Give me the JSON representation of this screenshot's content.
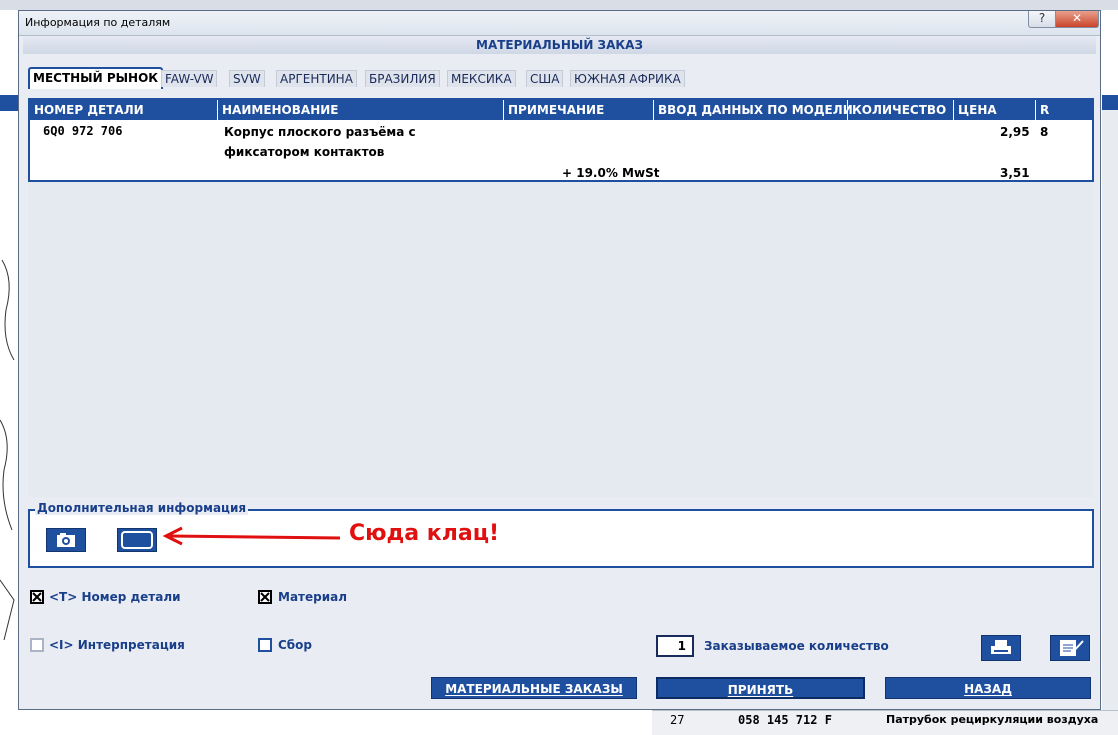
{
  "window": {
    "title": "Информация по деталям",
    "help_glyph": "?",
    "close_glyph": "✕"
  },
  "header": {
    "title": "МАТЕРИАЛЬНЫЙ ЗАКАЗ"
  },
  "tabs": [
    {
      "label": "МЕСТНЫЙ РЫНОК",
      "active": true
    },
    {
      "label": "FAW-VW",
      "active": false
    },
    {
      "label": "SVW",
      "active": false
    },
    {
      "label": "АРГЕНТИНА",
      "active": false
    },
    {
      "label": "БРАЗИЛИЯ",
      "active": false
    },
    {
      "label": "МЕКСИКА",
      "active": false
    },
    {
      "label": "США",
      "active": false
    },
    {
      "label": "ЮЖНАЯ АФРИКА",
      "active": false
    }
  ],
  "table": {
    "columns": [
      "НОМЕР ДЕТАЛИ",
      "НАИМЕНОВАНИЕ",
      "ПРИМЕЧАНИЕ",
      "ВВОД ДАННЫХ ПО МОДЕЛИ",
      "КОЛИЧЕСТВО",
      "ЦЕНА",
      "R"
    ],
    "row": {
      "part_number": "6Q0 972 706",
      "name_line1": "Корпус плоского разъёма с",
      "name_line2": "фиксатором контактов",
      "price": "2,95",
      "r": "8",
      "tax_label": "+ 19.0% MwSt",
      "tax_price": "3,51"
    }
  },
  "additional_info": {
    "legend": "Дополнительная информация",
    "annotation": "Сюда клац!"
  },
  "options": {
    "part_number": {
      "label": "<T> Номер детали",
      "checked": true
    },
    "material": {
      "label": "Материал",
      "checked": true
    },
    "interpretation": {
      "label": "<I> Интерпретация",
      "checked": false
    },
    "assembly": {
      "label": "Сбор",
      "checked": false
    }
  },
  "quantity": {
    "value": "1",
    "label": "Заказываемое количество"
  },
  "actions": {
    "orders": "МАТЕРИАЛЬНЫЕ ЗАКАЗЫ",
    "accept": "ПРИНЯТЬ",
    "back": "НАЗАД"
  },
  "background_row": {
    "index": "27",
    "part": "058 145 712 F",
    "name": "Патрубок рециркуляции воздуха"
  },
  "colors": {
    "accent": "#1f4f9f",
    "annotation": "#e01010"
  }
}
